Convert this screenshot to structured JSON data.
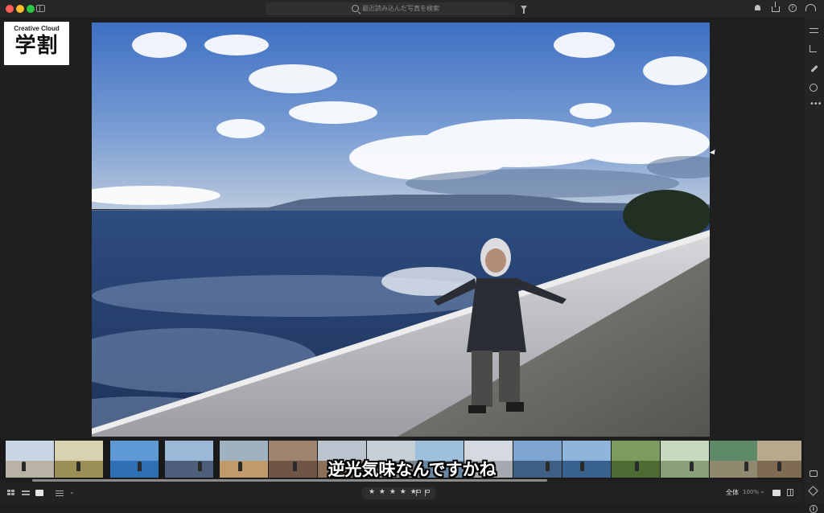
{
  "titlebar": {
    "search_placeholder": "最近読み込んだ写真を検索"
  },
  "logo": {
    "subtitle": "Creative Cloud",
    "main": "学割"
  },
  "filmstrip": {
    "thumbnails": [
      {
        "name": "beach-walk",
        "sky": "#c9d6e6",
        "ground": "#b9b3a6"
      },
      {
        "name": "horse-field",
        "sky": "#d9d2b0",
        "ground": "#9c8f56"
      },
      {
        "name": "coast-blue",
        "sky": "#5f9ad6",
        "ground": "#2f6fb4"
      },
      {
        "name": "seawall-selected",
        "sky": "#9cb8d8",
        "ground": "#4d5f7a"
      },
      {
        "name": "sand-dunes",
        "sky": "#9fb2c2",
        "ground": "#c19a6b"
      },
      {
        "name": "child-closeup",
        "sky": "#a08470",
        "ground": "#6e5546"
      },
      {
        "name": "street-group",
        "sky": "#b9c4cf",
        "ground": "#8b6f58"
      },
      {
        "name": "harbor-town",
        "sky": "#c7cfd7",
        "ground": "#7e858c"
      },
      {
        "name": "bay-mountain",
        "sky": "#9fc0dc",
        "ground": "#6b86a0"
      },
      {
        "name": "misty-coast",
        "sky": "#d4dae0",
        "ground": "#a5aab0"
      },
      {
        "name": "family-sea",
        "sky": "#7fa6d0",
        "ground": "#3f5f85"
      },
      {
        "name": "ocean-rocks",
        "sky": "#8fb5da",
        "ground": "#38618e"
      },
      {
        "name": "garden-party",
        "sky": "#7e9b60",
        "ground": "#4f6b34"
      },
      {
        "name": "park-kids",
        "sky": "#c7d9c0",
        "ground": "#8aa07a"
      },
      {
        "name": "green-board",
        "sky": "#5f8a6a",
        "ground": "#8f8a6f"
      },
      {
        "name": "picnic-group",
        "sky": "#b8a88c",
        "ground": "#7f6a52"
      },
      {
        "name": "shaded-crowd",
        "sky": "#8f7b62",
        "ground": "#5b4a38"
      }
    ]
  },
  "subtitle_text": "逆光気味なんですかね",
  "bottombar": {
    "stars": "★ ★ ★ ★ ★",
    "fit_label": "全体",
    "zoom_value": "100%"
  },
  "colors": {
    "background": "#1f1f1f",
    "accent_sky": "#4a78c0"
  }
}
